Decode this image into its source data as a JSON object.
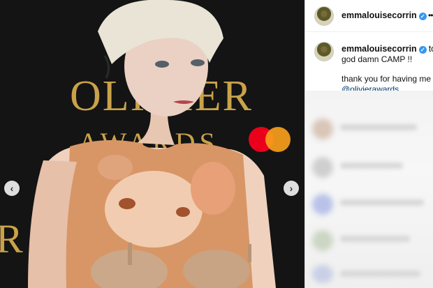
{
  "post": {
    "username": "emmalouisecorrin",
    "menu_icon": "more-options-icon",
    "verified_icon": "verified-badge-icon",
    "caption": {
      "username": "emmalouisecorrin",
      "lead": "to",
      "line2": "god damn CAMP !!",
      "line3": "thank you for having me",
      "mention": "@olivierawards"
    }
  },
  "photo": {
    "backdrop_letters_top": "OLIVIER",
    "backdrop_letters_bottom": "AWARDS",
    "backdrop_letter_side": "R",
    "brand_colors": {
      "gold": "#c9a24a",
      "red": "#eb001b",
      "orange": "#f79e1b"
    }
  },
  "navigation": {
    "prev_icon": "chevron-left-icon",
    "next_icon": "chevron-right-icon"
  },
  "comments": {
    "blurred": true
  }
}
